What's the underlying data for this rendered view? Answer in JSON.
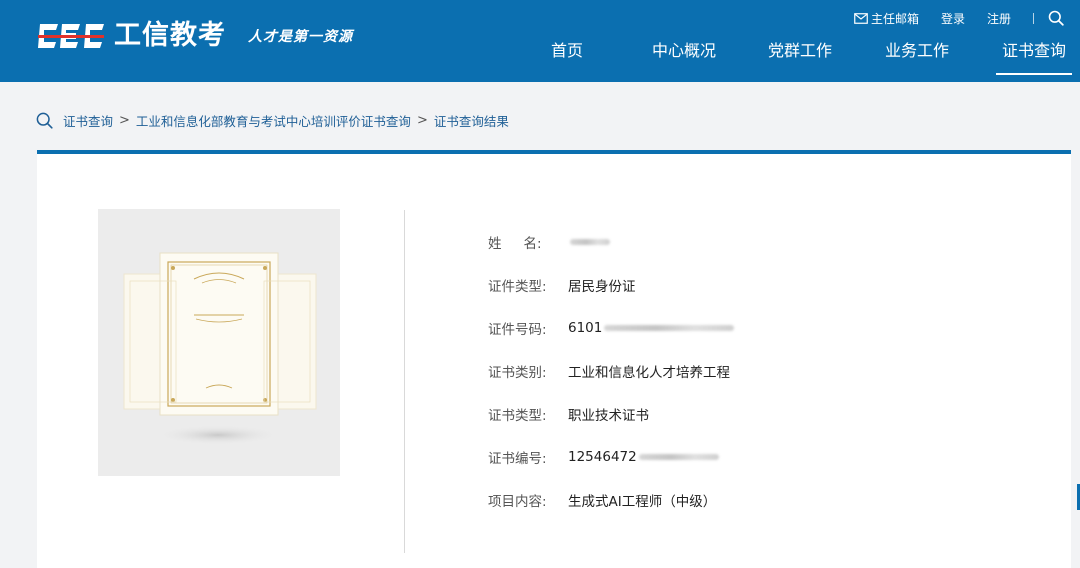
{
  "colors": {
    "brand_blue": "#0b6fb0",
    "link_blue": "#1f5f96",
    "page_bg": "#f2f3f5"
  },
  "header": {
    "logo_mark": "CEC",
    "logo_name": "工信教考",
    "slogan": "人才是第一资源",
    "top_links": {
      "mail": "主任邮箱",
      "login": "登录",
      "register": "注册"
    },
    "nav": [
      {
        "label": "首页"
      },
      {
        "label": "中心概况"
      },
      {
        "label": "党群工作"
      },
      {
        "label": "业务工作"
      },
      {
        "label": "证书查询",
        "active": true
      }
    ]
  },
  "breadcrumb": {
    "items": [
      "证书查询",
      "工业和信息化部教育与考试中心培训评价证书查询",
      "证书查询结果"
    ],
    "separator": ">"
  },
  "result": {
    "fields": [
      {
        "label": "姓名",
        "value": "",
        "masked": true
      },
      {
        "label": "证件类型:",
        "value": "居民身份证"
      },
      {
        "label": "证件号码:",
        "value": "6101",
        "masked": true
      },
      {
        "label": "证书类别:",
        "value": "工业和信息化人才培养工程"
      },
      {
        "label": "证书类型:",
        "value": "职业技术证书"
      },
      {
        "label": "证书编号:",
        "value": "12546472",
        "masked": true
      },
      {
        "label": "项目内容:",
        "value": "生成式AI工程师（中级）"
      }
    ],
    "name_label_chars": [
      "姓",
      "名:"
    ]
  }
}
